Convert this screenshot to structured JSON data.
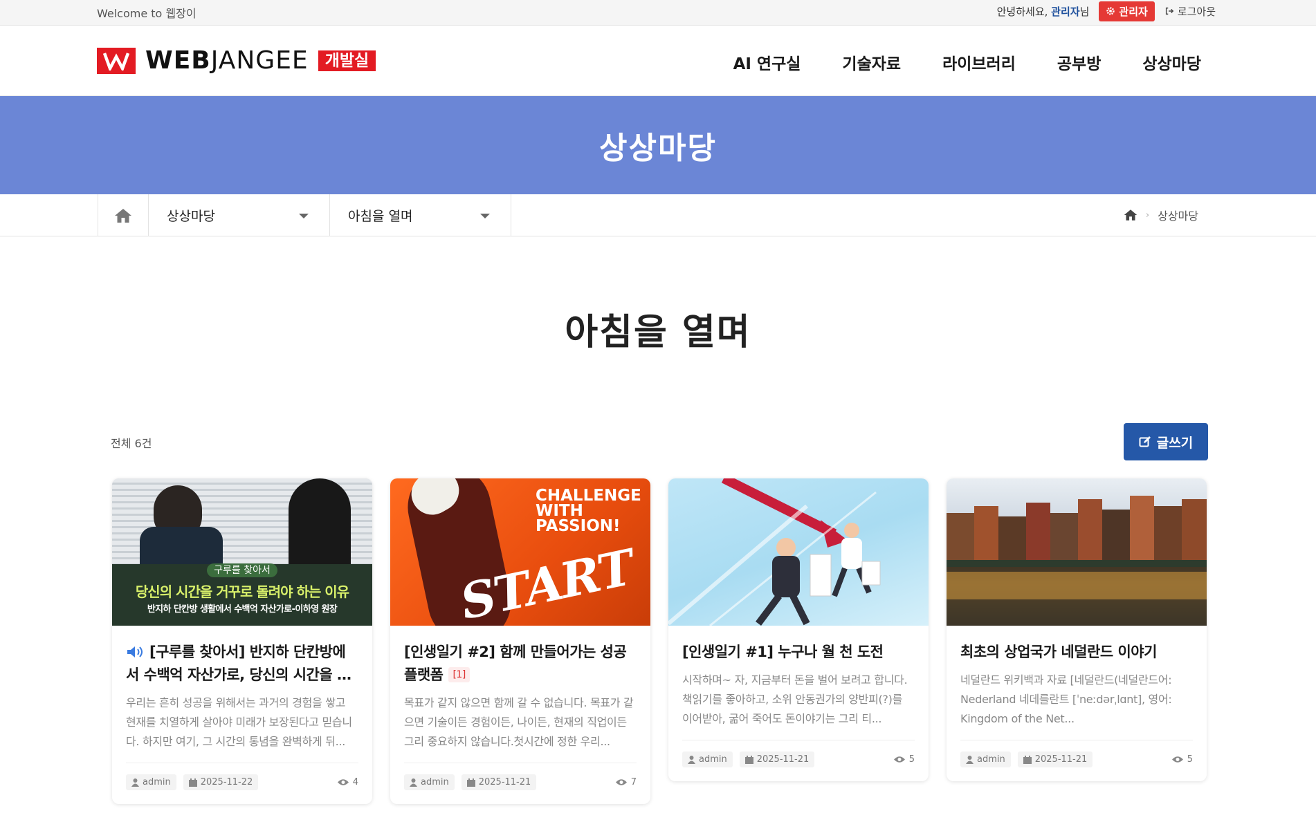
{
  "topbar": {
    "welcome": "Welcome to 웹장이",
    "greeting_prefix": "안녕하세요, ",
    "greeting_user": "관리자",
    "greeting_suffix": "님",
    "admin_label": "관리자",
    "logout_label": "로그아웃"
  },
  "header": {
    "brand_bold": "WEB",
    "brand_light": "JANGEE",
    "brand_tag": "개발실",
    "nav": [
      "AI 연구실",
      "기술자료",
      "라이브러리",
      "공부방",
      "상상마당"
    ]
  },
  "banner": {
    "title": "상상마당"
  },
  "subnav": {
    "menu1": "상상마당",
    "menu2": "아침을 열며",
    "crumb": "상상마당"
  },
  "page": {
    "title": "아침을 열며",
    "count_label": "전체 6건",
    "write_label": "글쓰기"
  },
  "cards": [
    {
      "thumb_badge": "구루를 찾아서",
      "thumb_headline": "당신의 시간을 거꾸로 돌려야 하는 이유",
      "thumb_sub": "반지하 단칸방 생활에서 수백억 자산가로-이하영 원장",
      "title": "[구루를 찾아서] 반지하 단칸방에서 수백억 자산가로, 당신의 시간을 …",
      "comment_count": "",
      "excerpt": "우리는 흔히 성공을 위해서는 과거의 경험을 쌓고 현재를 치열하게 살아야 미래가 보장된다고 믿습니다. 하지만 여기, 그 시간의 통념을 완벽하게 뒤...",
      "author": "admin",
      "date": "2025-11-22",
      "views": "4"
    },
    {
      "thumb_text1": "CHALLENGE",
      "thumb_text2": "WITH",
      "thumb_text3": "PASSION!",
      "thumb_script": "START",
      "title": "[인생일기 #2] 함께 만들어가는 성공플랫폼",
      "comment_count": "[1]",
      "excerpt": "목표가 같지 않으면 함께 갈 수 없습니다. 목표가 같으면 기술이든 경험이든, 나이든, 현재의 직업이든 그리 중요하지 않습니다.첫시간에 정한 우리...",
      "author": "admin",
      "date": "2025-11-21",
      "views": "7"
    },
    {
      "title": "[인생일기 #1] 누구나 월 천 도전",
      "comment_count": "",
      "excerpt": "시작하며~ 자, 지금부터 돈을 벌어 보려고 합니다. 책읽기를 좋아하고, 소위 안동권가의 양반피(?)를 이어받아, 굶어 죽어도 돈이야기는 그리 티...",
      "author": "admin",
      "date": "2025-11-21",
      "views": "5"
    },
    {
      "title": "최초의 상업국가 네덜란드 이야기",
      "comment_count": "",
      "excerpt": "네덜란드 위키백과 자료 [네덜란드(네덜란드어: Nederland 네데를란트 [ˈneːdərˌlɑnt], 영어: Kingdom of the Net...",
      "author": "admin",
      "date": "2025-11-21",
      "views": "5"
    }
  ],
  "colors": {
    "brand_red": "#e31b23",
    "banner_blue": "#6b86d6",
    "write_button": "#2558a8",
    "admin_badge": "#e53935"
  }
}
